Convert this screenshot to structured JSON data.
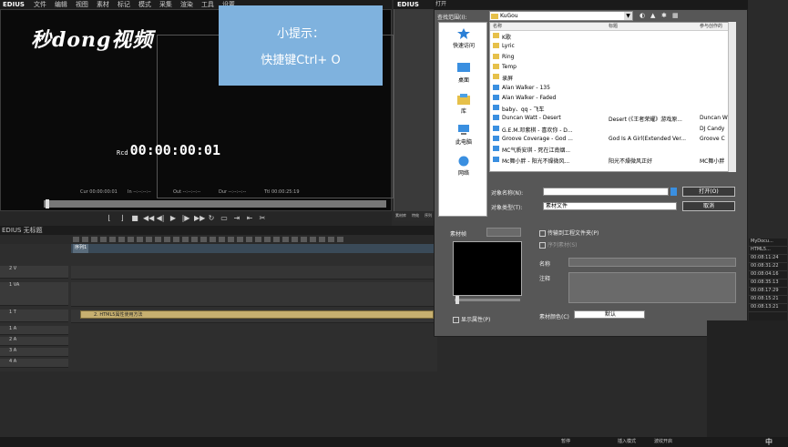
{
  "app": {
    "name": "EDIUS",
    "menu": [
      "文件",
      "编辑",
      "视图",
      "素材",
      "标记",
      "模式",
      "采集",
      "渲染",
      "工具",
      "设置"
    ]
  },
  "watermark": "秒dong视频",
  "tip": {
    "line1": "小提示：",
    "line2": "快捷键Ctrl+ O"
  },
  "preview": {
    "timecode_prefix": "Rcd",
    "timecode": "00:00:00:01",
    "cur": "Cur 00:00:00:01",
    "in": "In --:--:--:--",
    "out": "Out --:--:--:--",
    "dur": "Dur --:--:--:--",
    "ttl": "Ttl 00:00:25:19"
  },
  "right_panel": {
    "title": "EDIUS",
    "tabs": [
      "素材库",
      "特效",
      "序列"
    ]
  },
  "timeline": {
    "menu": "EDIUS 无标题",
    "seq_tab": "序列1",
    "tracks": [
      {
        "label": "2 V"
      },
      {
        "label": "1 VA"
      },
      {
        "label": "1 T"
      },
      {
        "label": "1 A"
      },
      {
        "label": "2 A"
      },
      {
        "label": "3 A"
      },
      {
        "label": "4 A"
      }
    ],
    "clip_label": "2. HTML5属性使用方法"
  },
  "dialog": {
    "title": "打开",
    "lookin_label": "查找范围(I):",
    "lookin_value": "KuGou",
    "places": [
      "快速访问",
      "桌面",
      "库",
      "此电脑",
      "网络"
    ],
    "columns": [
      "名称",
      "标题",
      "参与创作的"
    ],
    "files": [
      {
        "name": "K歌",
        "title": "",
        "artist": "",
        "type": "folder"
      },
      {
        "name": "Lyric",
        "title": "",
        "artist": "",
        "type": "folder"
      },
      {
        "name": "Ring",
        "title": "",
        "artist": "",
        "type": "folder"
      },
      {
        "name": "Temp",
        "title": "",
        "artist": "",
        "type": "folder"
      },
      {
        "name": "录屏",
        "title": "",
        "artist": "",
        "type": "folder"
      },
      {
        "name": "Alan Walker - 135",
        "title": "",
        "artist": "",
        "type": "file"
      },
      {
        "name": "Alan Walker - Faded",
        "title": "",
        "artist": "",
        "type": "file"
      },
      {
        "name": "baby、qq - 飞车",
        "title": "",
        "artist": "",
        "type": "file"
      },
      {
        "name": "Duncan Watt - Desert",
        "title": "Desert (《王者荣耀》游戏原...",
        "artist": "Duncan W",
        "type": "file"
      },
      {
        "name": "G.E.M.邓紫棋 - 喜欢你 - D...",
        "title": "",
        "artist": "DJ Candy",
        "type": "file"
      },
      {
        "name": "Groove Coverage - God ...",
        "title": "God Is A Girl(Extended Ver...",
        "artist": "Groove C",
        "type": "file"
      },
      {
        "name": "MC气质安琪 - 死在江南烟...",
        "title": "",
        "artist": "",
        "type": "file"
      },
      {
        "name": "Mc舞小胖 - 阳光不燥微风...",
        "title": "阳光不燥微风正好",
        "artist": "MC舞小胖",
        "type": "file"
      }
    ],
    "filename_label": "对象名称(N):",
    "filename_value": "",
    "filetype_label": "对象类型(T):",
    "filetype_value": "素材文件",
    "open_btn": "打开(O)",
    "cancel_btn": "取消",
    "thumb_label": "素材帧",
    "show_props": "显示属性(P)",
    "copy_to_project": "传输到工程文件夹(P)",
    "add_to_seq": "序列素材(S)",
    "name_label": "名称",
    "comment_label": "注释",
    "clip_color_label": "素材颜色(C)",
    "clip_color_value": "默认"
  },
  "side_column": [
    "MyDocu...",
    "HTML5...",
    "00:08:11:24",
    "00:08:31:22",
    "00:08:04:16",
    "00:08:35:13",
    "00:08:17:29",
    "00:08:15:21",
    "00:08:13:21"
  ],
  "status": {
    "pause": "暂停",
    "insert": "插入模式",
    "ripple": "波纹开启",
    "ime": "中"
  },
  "colors": {
    "tip_bg": "#7fb2de",
    "clip": "#c7b070",
    "folder": "#e6c04a"
  }
}
